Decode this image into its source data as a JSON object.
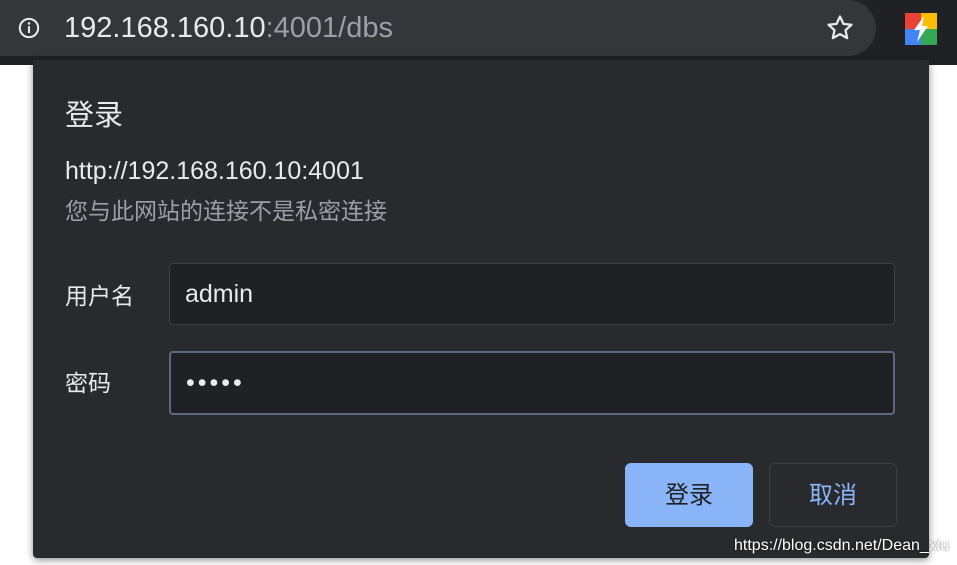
{
  "browser": {
    "url_host": "192.168.160.10",
    "url_rest": ":4001/dbs",
    "icons": {
      "site_info": "info-icon",
      "bookmark": "star-icon",
      "extension": "extension-icon"
    }
  },
  "dialog": {
    "title": "登录",
    "origin": "http://192.168.160.10:4001",
    "warning": "您与此网站的连接不是私密连接",
    "username": {
      "label": "用户名",
      "value": "admin"
    },
    "password": {
      "label": "密码",
      "value": "•••••"
    },
    "buttons": {
      "login": "登录",
      "cancel": "取消"
    }
  },
  "watermark": "https://blog.csdn.net/Dean_xiu",
  "colors": {
    "dialog_bg": "#292a2d",
    "field_bg": "#202124",
    "accent": "#8ab4f8",
    "text": "#e8eaed",
    "muted": "#9aa0a6"
  }
}
